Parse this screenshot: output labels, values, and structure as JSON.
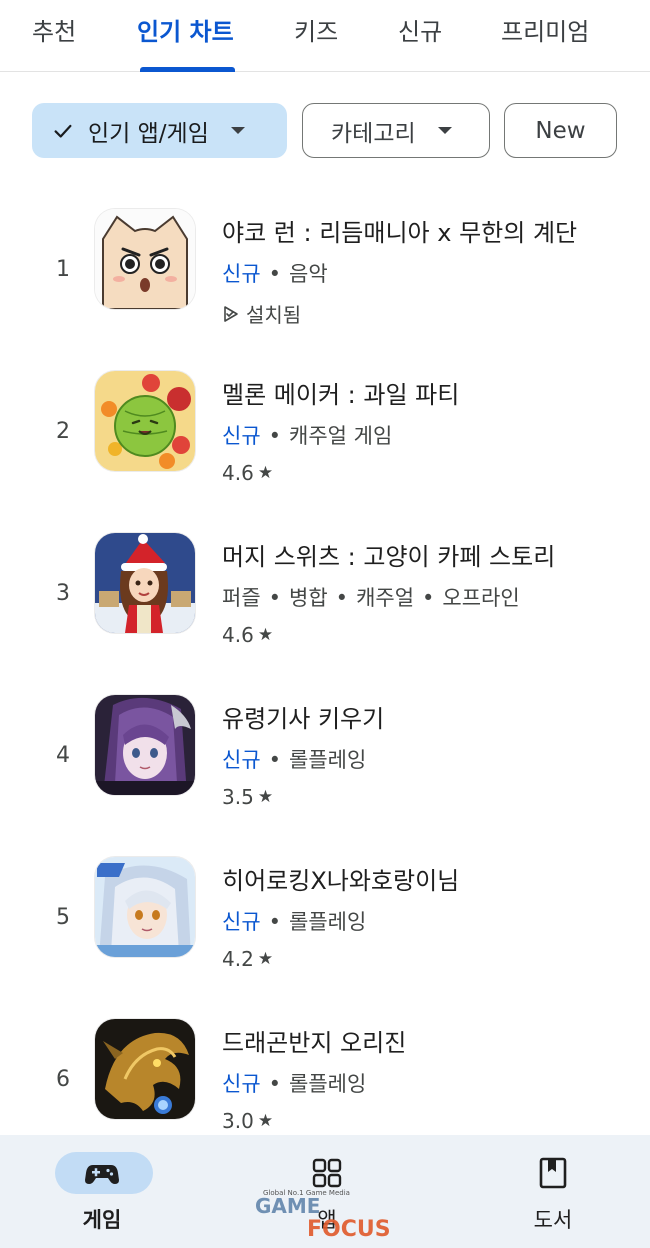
{
  "tabs": [
    {
      "label": "추천"
    },
    {
      "label": "인기 차트",
      "active": true
    },
    {
      "label": "키즈"
    },
    {
      "label": "신규"
    },
    {
      "label": "프리미엄"
    }
  ],
  "filters": {
    "primary": "인기 앱/게임",
    "category": "카테고리",
    "new": "New"
  },
  "apps": [
    {
      "rank": "1",
      "title": "야코 런 : 리듬매니아 x 무한의 계단",
      "badge": "신규",
      "tags": [
        "음악"
      ],
      "sub": "설치됨",
      "sub_icon": "installed-icon"
    },
    {
      "rank": "2",
      "title": "멜론 메이커 : 과일 파티",
      "badge": "신규",
      "tags": [
        "캐주얼 게임"
      ],
      "rating": "4.6"
    },
    {
      "rank": "3",
      "title": "머지 스위츠 : 고양이 카페 스토리",
      "badge": "",
      "tags": [
        "퍼즐",
        "병합",
        "캐주얼",
        "오프라인"
      ],
      "rating": "4.6"
    },
    {
      "rank": "4",
      "title": "유령기사 키우기",
      "badge": "신규",
      "tags": [
        "롤플레잉"
      ],
      "rating": "3.5"
    },
    {
      "rank": "5",
      "title": "히어로킹X나와호랑이님",
      "badge": "신규",
      "tags": [
        "롤플레잉"
      ],
      "rating": "4.2"
    },
    {
      "rank": "6",
      "title": "드래곤반지 오리진",
      "badge": "신규",
      "tags": [
        "롤플레잉"
      ],
      "rating": "3.0"
    }
  ],
  "bottom_nav": {
    "games": "게임",
    "apps": "앱",
    "books": "도서"
  },
  "watermark": {
    "tagline": "Global No.1 Game Media",
    "word1": "GAME",
    "word2": "FOCUS"
  },
  "colors": {
    "accent": "#0b57d0",
    "chip_selected": "#c9e3f8",
    "nav_background": "#edf2f7",
    "nav_pill": "#c2dcf5"
  }
}
